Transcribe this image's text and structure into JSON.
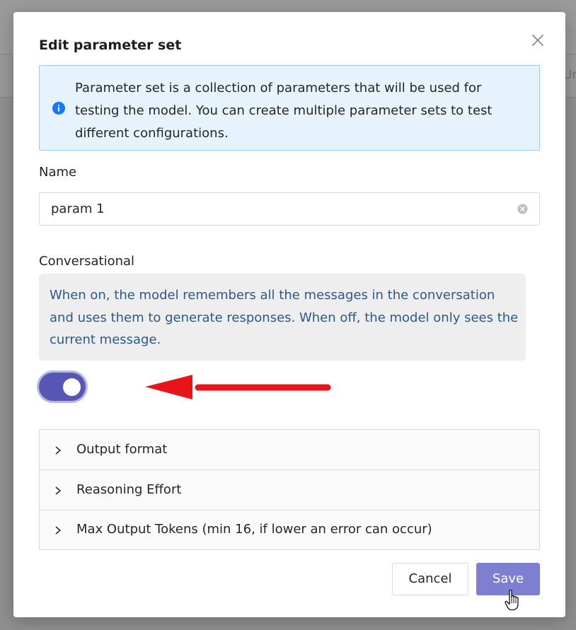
{
  "background": {
    "partial_text": "Ur"
  },
  "modal": {
    "title": "Edit parameter set",
    "close_icon": "close-icon",
    "info": {
      "icon": "info-icon",
      "text": "Parameter set is a collection of parameters that will be used for testing the model. You can create multiple parameter sets to test different configurations."
    },
    "name": {
      "label": "Name",
      "value": "param 1",
      "clear_icon": "clear-circle-icon"
    },
    "conversational": {
      "label": "Conversational",
      "description": "When on, the model remembers all the messages in the conversation and uses them to generate responses. When off, the model only sees the current message.",
      "enabled": true
    },
    "annotation": {
      "arrow_color": "#e8141a"
    },
    "accordion": [
      {
        "label": "Output format"
      },
      {
        "label": "Reasoning Effort"
      },
      {
        "label": "Max Output Tokens (min 16, if lower an error can occur)"
      }
    ],
    "buttons": {
      "cancel": "Cancel",
      "save": "Save"
    }
  },
  "colors": {
    "accent": "#5756b4",
    "save_button": "#7f7fd2",
    "info_background": "#e6f3fd",
    "info_icon": "#1677ff",
    "description_text": "#2c5a86"
  }
}
